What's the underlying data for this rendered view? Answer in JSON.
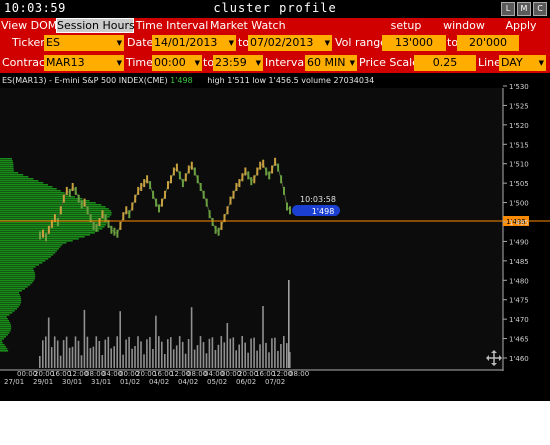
{
  "titlebar": {
    "clock": "10:03:59",
    "title": "cluster profile",
    "buttons": [
      "L",
      "M",
      "C"
    ]
  },
  "menubar": {
    "view_dom": "View DOM",
    "session_hours": "Session Hours",
    "time_interval": "Time Interval",
    "market_watch": "Market Watch",
    "setup": "setup",
    "window": "window",
    "apply": "Apply"
  },
  "row1": {
    "ticker_label": "Ticker",
    "ticker": "ES",
    "date_label": "Date",
    "date_from": "14/01/2013",
    "to_label": "to",
    "date_to": "07/02/2013",
    "vol_label": "Vol range",
    "vol_from": "13'000",
    "vol_to_label": "to",
    "vol_to": "20'000"
  },
  "row2": {
    "contract_label": "Contract",
    "contract": "MAR13",
    "time_label": "Time",
    "time_from": "00:00",
    "to_label": "to",
    "time_to": "23:59",
    "interval_label": "Interval",
    "interval": "60 MIN",
    "price_scale_label": "Price Scale",
    "price_scale": "0.25",
    "line_label": "Line",
    "line": "DAY"
  },
  "chart_info": {
    "symbol": "ES(MAR13) - E-mini S&P 500 INDEX(CME)",
    "last": "1'498",
    "high_low_vol": "high 1'511  low 1'456.5  volume 27034034"
  },
  "crosshair": {
    "time": "10:03:58",
    "price": "1'498"
  },
  "current_price_label": "1'495",
  "colors": {
    "menubar": "#d00000",
    "field": "#ffae00",
    "volume_profile": "#1a8c1a",
    "price_line": "#ff8c00",
    "cursor_badge": "#1b3fd0"
  },
  "chart_data": {
    "type": "line",
    "y_axis_ticks": [
      "1'530",
      "1'525",
      "1'520",
      "1'515",
      "1'510",
      "1'505",
      "1'500",
      "1'495",
      "1'490",
      "1'485",
      "1'480",
      "1'475",
      "1'470",
      "1'465",
      "1'460"
    ],
    "ylim": [
      1458,
      1532
    ],
    "x_time_labels": [
      "00:00",
      "20:00",
      "16:00",
      "12:00",
      "08:00",
      "04:00",
      "00:00",
      "20:00",
      "16:00",
      "12:00",
      "08:00",
      "04:00",
      "00:00",
      "20:00",
      "16:00",
      "12:00",
      "08:00"
    ],
    "x_date_labels": [
      "27/01",
      "29/01",
      "30/01",
      "31/01",
      "01/02",
      "04/02",
      "04/02",
      "05/02",
      "06/02",
      "07/02"
    ],
    "price_series": [
      1491.5,
      1492,
      1491,
      1493,
      1494.5,
      1496,
      1495,
      1498,
      1501,
      1503,
      1502.5,
      1504,
      1503,
      1501,
      1499.5,
      1500,
      1498,
      1496,
      1494,
      1493.5,
      1495,
      1497,
      1496,
      1494.5,
      1493,
      1492.5,
      1492,
      1494,
      1496.5,
      1498,
      1497,
      1499,
      1501,
      1503,
      1504,
      1505,
      1506,
      1504.5,
      1502,
      1500,
      1498.5,
      1500,
      1502,
      1504.5,
      1506,
      1508,
      1509,
      1507,
      1505,
      1506.5,
      1508.5,
      1509.5,
      1508,
      1506,
      1504,
      1502,
      1500,
      1497,
      1495,
      1493,
      1492.5,
      1494,
      1496,
      1498,
      1500.5,
      1502,
      1504,
      1505,
      1506.5,
      1508,
      1507,
      1505.5,
      1506,
      1508,
      1509.5,
      1510,
      1508,
      1507,
      1508.5,
      1510.5,
      1509,
      1506,
      1503,
      1499,
      1498
    ],
    "volume_profile": [
      0,
      0,
      0,
      0,
      0,
      0,
      0,
      0,
      0,
      0,
      0,
      0,
      0,
      0,
      0,
      0,
      0,
      0,
      0,
      0,
      0,
      0,
      0,
      0,
      0,
      0,
      0,
      0,
      0,
      0,
      0,
      0,
      0,
      0,
      0,
      0,
      0,
      0,
      0,
      0,
      0,
      0,
      0,
      0,
      0,
      0,
      0,
      0,
      0,
      0,
      0,
      0,
      0,
      0,
      0,
      0,
      0,
      0,
      0,
      0,
      0,
      0,
      0,
      0,
      0,
      0,
      0,
      0,
      0,
      0,
      0,
      0,
      0,
      0,
      0,
      0,
      0,
      0,
      0,
      0,
      0,
      0,
      0,
      0,
      0,
      0,
      0,
      0,
      0,
      0,
      0,
      0,
      0,
      0,
      0,
      0,
      0,
      0,
      0,
      0,
      0,
      0,
      0,
      0,
      0,
      0,
      0,
      0,
      0,
      0,
      0,
      0,
      0,
      0,
      0,
      0,
      0,
      0,
      0,
      0,
      0,
      0,
      0,
      0,
      0,
      0,
      0,
      0,
      0,
      0,
      0,
      0,
      0,
      0,
      0,
      0,
      0,
      0,
      0,
      0,
      0,
      0,
      0,
      0,
      0,
      0,
      0,
      0,
      0,
      0
    ]
  }
}
